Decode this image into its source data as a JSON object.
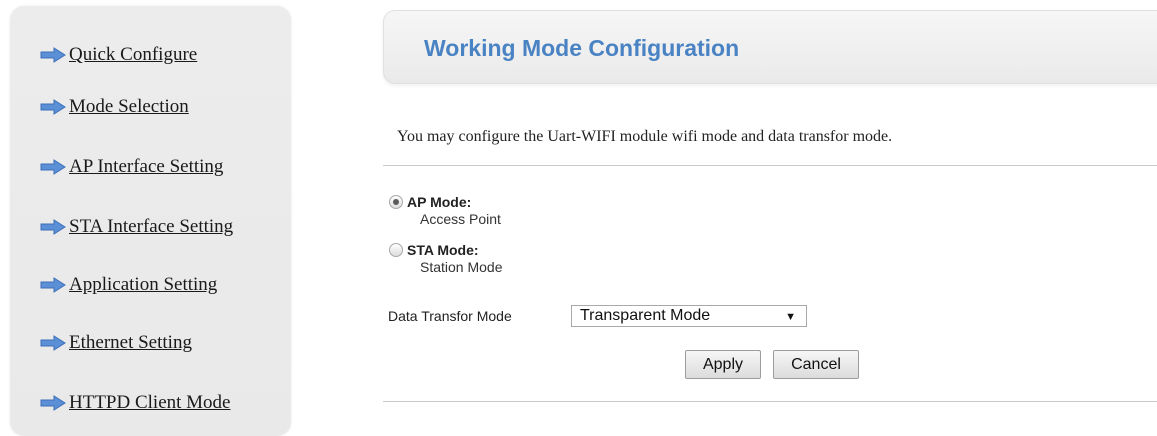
{
  "sidebar": {
    "items": [
      {
        "label": "Quick Configure",
        "icon": "arrow-right-icon"
      },
      {
        "label": "Mode Selection",
        "icon": "arrow-right-icon"
      },
      {
        "label": "AP Interface Setting",
        "icon": "arrow-right-icon"
      },
      {
        "label": "STA Interface Setting",
        "icon": "arrow-right-icon"
      },
      {
        "label": "Application Setting",
        "icon": "arrow-right-icon"
      },
      {
        "label": "Ethernet Setting",
        "icon": "arrow-right-icon"
      },
      {
        "label": "HTTPD Client Mode",
        "icon": "arrow-right-icon"
      }
    ]
  },
  "header": {
    "title": "Working Mode Configuration"
  },
  "main": {
    "intro": "You may configure the Uart-WIFI module wifi mode and data transfor mode.",
    "modes": [
      {
        "title": "AP Mode:",
        "description": "Access Point",
        "selected": true
      },
      {
        "title": "STA Mode:",
        "description": "Station Mode",
        "selected": false
      }
    ],
    "data_transfer": {
      "label": "Data Transfor Mode",
      "selected": "Transparent Mode"
    },
    "buttons": {
      "apply": "Apply",
      "cancel": "Cancel"
    }
  },
  "colors": {
    "title": "#4a83c3",
    "arrow": "#5b8fd6",
    "sidebar_bg": "#ececec"
  }
}
